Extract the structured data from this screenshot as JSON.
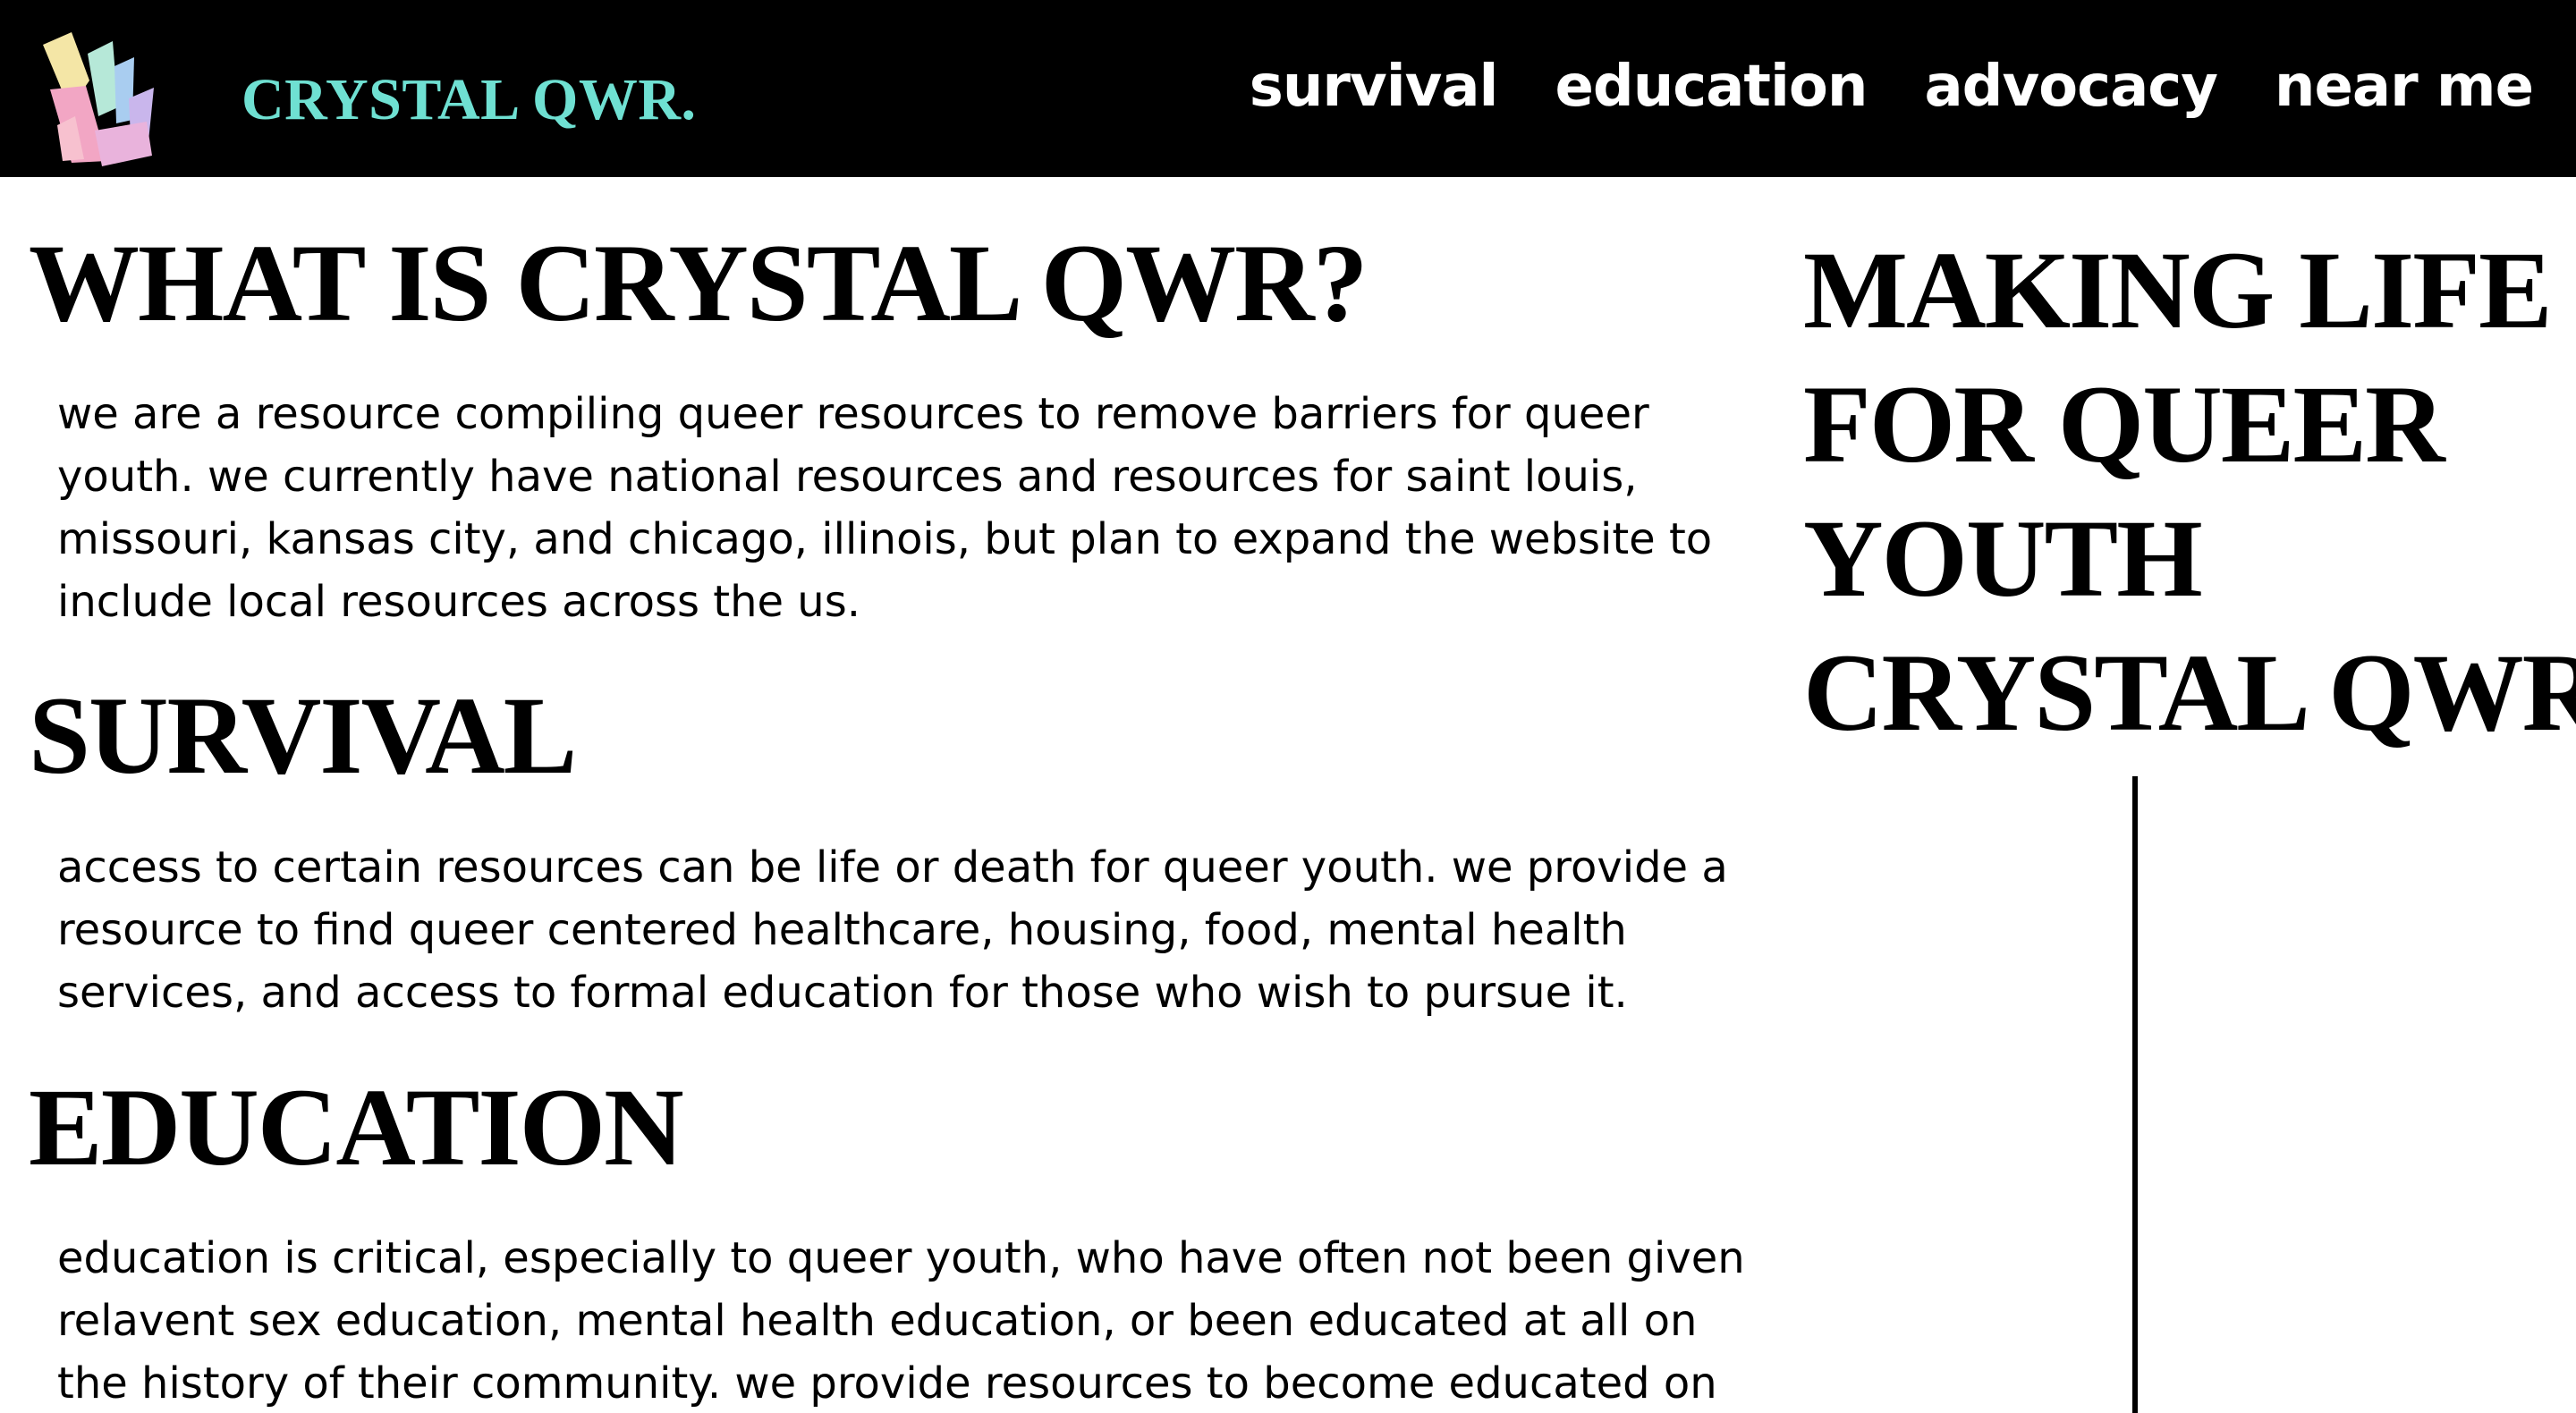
{
  "header": {
    "brand": "CRYSTAL QWR.",
    "logo_icon": "crystal-cluster-icon",
    "nav": [
      {
        "label": "survival"
      },
      {
        "label": "education"
      },
      {
        "label": "advocacy"
      },
      {
        "label": "near me"
      }
    ]
  },
  "main": {
    "sections": [
      {
        "title": "WHAT IS CRYSTAL QWR?",
        "body": "we are a resource compiling queer resources to remove barriers for queer youth. we currently have national resources and resources for saint louis, missouri, kansas city, and chicago, illinois, but plan to expand the website to include local resources across the us."
      },
      {
        "title": "SURVIVAL",
        "body": "access to certain resources can be life or death for queer youth. we provide a resource to find queer centered healthcare, housing, food, mental health services, and access to formal education for those who wish to pursue it."
      },
      {
        "title": "EDUCATION",
        "body": "education is critical, especially to queer youth, who have often not been given relavent sex education, mental health education, or been educated at all on the history of their community. we provide resources to become educated on"
      }
    ]
  },
  "sidebar": {
    "title_lines": [
      "MAKING LIFE",
      "FOR QUEER",
      "YOUTH",
      "CRYSTAL QWR"
    ]
  },
  "colors": {
    "header_bg": "#000000",
    "brand": "#6fe0d2",
    "nav_text": "#ffffff",
    "crystal_yellow": "#f4e6a6",
    "crystal_pink": "#f2a6c4",
    "crystal_teal": "#9fe3d6",
    "crystal_blue": "#a9cdf0",
    "crystal_lavender": "#c9b6ec"
  }
}
